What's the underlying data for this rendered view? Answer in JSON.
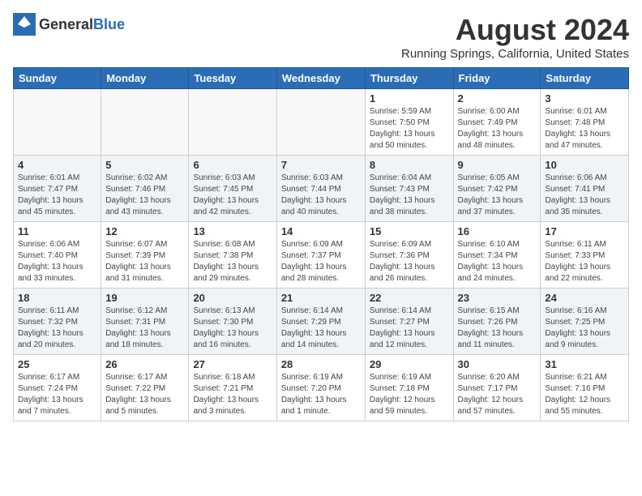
{
  "header": {
    "logo_general": "General",
    "logo_blue": "Blue",
    "month_year": "August 2024",
    "location": "Running Springs, California, United States"
  },
  "days_of_week": [
    "Sunday",
    "Monday",
    "Tuesday",
    "Wednesday",
    "Thursday",
    "Friday",
    "Saturday"
  ],
  "weeks": [
    [
      {
        "num": "",
        "info": ""
      },
      {
        "num": "",
        "info": ""
      },
      {
        "num": "",
        "info": ""
      },
      {
        "num": "",
        "info": ""
      },
      {
        "num": "1",
        "info": "Sunrise: 5:59 AM\nSunset: 7:50 PM\nDaylight: 13 hours\nand 50 minutes."
      },
      {
        "num": "2",
        "info": "Sunrise: 6:00 AM\nSunset: 7:49 PM\nDaylight: 13 hours\nand 48 minutes."
      },
      {
        "num": "3",
        "info": "Sunrise: 6:01 AM\nSunset: 7:48 PM\nDaylight: 13 hours\nand 47 minutes."
      }
    ],
    [
      {
        "num": "4",
        "info": "Sunrise: 6:01 AM\nSunset: 7:47 PM\nDaylight: 13 hours\nand 45 minutes."
      },
      {
        "num": "5",
        "info": "Sunrise: 6:02 AM\nSunset: 7:46 PM\nDaylight: 13 hours\nand 43 minutes."
      },
      {
        "num": "6",
        "info": "Sunrise: 6:03 AM\nSunset: 7:45 PM\nDaylight: 13 hours\nand 42 minutes."
      },
      {
        "num": "7",
        "info": "Sunrise: 6:03 AM\nSunset: 7:44 PM\nDaylight: 13 hours\nand 40 minutes."
      },
      {
        "num": "8",
        "info": "Sunrise: 6:04 AM\nSunset: 7:43 PM\nDaylight: 13 hours\nand 38 minutes."
      },
      {
        "num": "9",
        "info": "Sunrise: 6:05 AM\nSunset: 7:42 PM\nDaylight: 13 hours\nand 37 minutes."
      },
      {
        "num": "10",
        "info": "Sunrise: 6:06 AM\nSunset: 7:41 PM\nDaylight: 13 hours\nand 35 minutes."
      }
    ],
    [
      {
        "num": "11",
        "info": "Sunrise: 6:06 AM\nSunset: 7:40 PM\nDaylight: 13 hours\nand 33 minutes."
      },
      {
        "num": "12",
        "info": "Sunrise: 6:07 AM\nSunset: 7:39 PM\nDaylight: 13 hours\nand 31 minutes."
      },
      {
        "num": "13",
        "info": "Sunrise: 6:08 AM\nSunset: 7:38 PM\nDaylight: 13 hours\nand 29 minutes."
      },
      {
        "num": "14",
        "info": "Sunrise: 6:09 AM\nSunset: 7:37 PM\nDaylight: 13 hours\nand 28 minutes."
      },
      {
        "num": "15",
        "info": "Sunrise: 6:09 AM\nSunset: 7:36 PM\nDaylight: 13 hours\nand 26 minutes."
      },
      {
        "num": "16",
        "info": "Sunrise: 6:10 AM\nSunset: 7:34 PM\nDaylight: 13 hours\nand 24 minutes."
      },
      {
        "num": "17",
        "info": "Sunrise: 6:11 AM\nSunset: 7:33 PM\nDaylight: 13 hours\nand 22 minutes."
      }
    ],
    [
      {
        "num": "18",
        "info": "Sunrise: 6:11 AM\nSunset: 7:32 PM\nDaylight: 13 hours\nand 20 minutes."
      },
      {
        "num": "19",
        "info": "Sunrise: 6:12 AM\nSunset: 7:31 PM\nDaylight: 13 hours\nand 18 minutes."
      },
      {
        "num": "20",
        "info": "Sunrise: 6:13 AM\nSunset: 7:30 PM\nDaylight: 13 hours\nand 16 minutes."
      },
      {
        "num": "21",
        "info": "Sunrise: 6:14 AM\nSunset: 7:29 PM\nDaylight: 13 hours\nand 14 minutes."
      },
      {
        "num": "22",
        "info": "Sunrise: 6:14 AM\nSunset: 7:27 PM\nDaylight: 13 hours\nand 12 minutes."
      },
      {
        "num": "23",
        "info": "Sunrise: 6:15 AM\nSunset: 7:26 PM\nDaylight: 13 hours\nand 11 minutes."
      },
      {
        "num": "24",
        "info": "Sunrise: 6:16 AM\nSunset: 7:25 PM\nDaylight: 13 hours\nand 9 minutes."
      }
    ],
    [
      {
        "num": "25",
        "info": "Sunrise: 6:17 AM\nSunset: 7:24 PM\nDaylight: 13 hours\nand 7 minutes."
      },
      {
        "num": "26",
        "info": "Sunrise: 6:17 AM\nSunset: 7:22 PM\nDaylight: 13 hours\nand 5 minutes."
      },
      {
        "num": "27",
        "info": "Sunrise: 6:18 AM\nSunset: 7:21 PM\nDaylight: 13 hours\nand 3 minutes."
      },
      {
        "num": "28",
        "info": "Sunrise: 6:19 AM\nSunset: 7:20 PM\nDaylight: 13 hours\nand 1 minute."
      },
      {
        "num": "29",
        "info": "Sunrise: 6:19 AM\nSunset: 7:18 PM\nDaylight: 12 hours\nand 59 minutes."
      },
      {
        "num": "30",
        "info": "Sunrise: 6:20 AM\nSunset: 7:17 PM\nDaylight: 12 hours\nand 57 minutes."
      },
      {
        "num": "31",
        "info": "Sunrise: 6:21 AM\nSunset: 7:16 PM\nDaylight: 12 hours\nand 55 minutes."
      }
    ]
  ]
}
